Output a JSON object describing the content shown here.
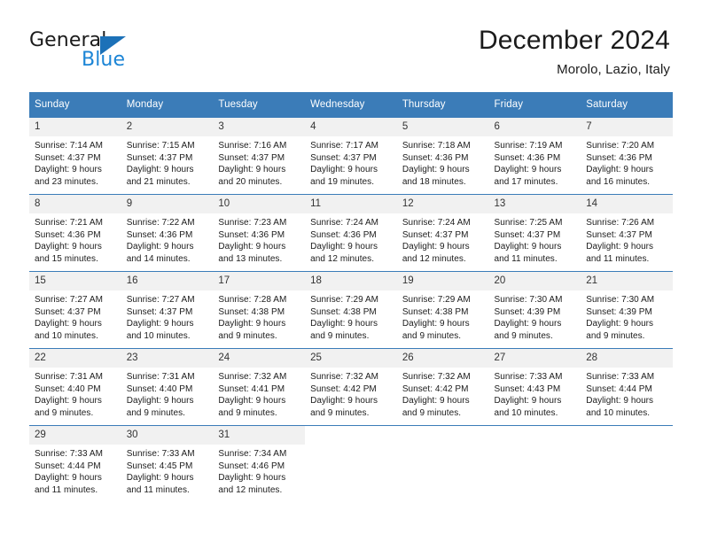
{
  "brand": {
    "name_dark": "General",
    "name_blue": "Blue",
    "accent_blue": "#1c85d6",
    "triangle_blue": "#1c71b8"
  },
  "header": {
    "title": "December 2024",
    "subtitle": "Morolo, Lazio, Italy"
  },
  "theme": {
    "header_bg": "#3b7cb8",
    "header_text": "#ffffff",
    "daynum_bg": "#f1f1f1",
    "cell_bg": "#ffffff",
    "grid_line": "#3b7cb8"
  },
  "weekdays": [
    "Sunday",
    "Monday",
    "Tuesday",
    "Wednesday",
    "Thursday",
    "Friday",
    "Saturday"
  ],
  "weeks": [
    [
      {
        "day": "1",
        "lines": [
          "Sunrise: 7:14 AM",
          "Sunset: 4:37 PM",
          "Daylight: 9 hours",
          "and 23 minutes."
        ]
      },
      {
        "day": "2",
        "lines": [
          "Sunrise: 7:15 AM",
          "Sunset: 4:37 PM",
          "Daylight: 9 hours",
          "and 21 minutes."
        ]
      },
      {
        "day": "3",
        "lines": [
          "Sunrise: 7:16 AM",
          "Sunset: 4:37 PM",
          "Daylight: 9 hours",
          "and 20 minutes."
        ]
      },
      {
        "day": "4",
        "lines": [
          "Sunrise: 7:17 AM",
          "Sunset: 4:37 PM",
          "Daylight: 9 hours",
          "and 19 minutes."
        ]
      },
      {
        "day": "5",
        "lines": [
          "Sunrise: 7:18 AM",
          "Sunset: 4:36 PM",
          "Daylight: 9 hours",
          "and 18 minutes."
        ]
      },
      {
        "day": "6",
        "lines": [
          "Sunrise: 7:19 AM",
          "Sunset: 4:36 PM",
          "Daylight: 9 hours",
          "and 17 minutes."
        ]
      },
      {
        "day": "7",
        "lines": [
          "Sunrise: 7:20 AM",
          "Sunset: 4:36 PM",
          "Daylight: 9 hours",
          "and 16 minutes."
        ]
      }
    ],
    [
      {
        "day": "8",
        "lines": [
          "Sunrise: 7:21 AM",
          "Sunset: 4:36 PM",
          "Daylight: 9 hours",
          "and 15 minutes."
        ]
      },
      {
        "day": "9",
        "lines": [
          "Sunrise: 7:22 AM",
          "Sunset: 4:36 PM",
          "Daylight: 9 hours",
          "and 14 minutes."
        ]
      },
      {
        "day": "10",
        "lines": [
          "Sunrise: 7:23 AM",
          "Sunset: 4:36 PM",
          "Daylight: 9 hours",
          "and 13 minutes."
        ]
      },
      {
        "day": "11",
        "lines": [
          "Sunrise: 7:24 AM",
          "Sunset: 4:36 PM",
          "Daylight: 9 hours",
          "and 12 minutes."
        ]
      },
      {
        "day": "12",
        "lines": [
          "Sunrise: 7:24 AM",
          "Sunset: 4:37 PM",
          "Daylight: 9 hours",
          "and 12 minutes."
        ]
      },
      {
        "day": "13",
        "lines": [
          "Sunrise: 7:25 AM",
          "Sunset: 4:37 PM",
          "Daylight: 9 hours",
          "and 11 minutes."
        ]
      },
      {
        "day": "14",
        "lines": [
          "Sunrise: 7:26 AM",
          "Sunset: 4:37 PM",
          "Daylight: 9 hours",
          "and 11 minutes."
        ]
      }
    ],
    [
      {
        "day": "15",
        "lines": [
          "Sunrise: 7:27 AM",
          "Sunset: 4:37 PM",
          "Daylight: 9 hours",
          "and 10 minutes."
        ]
      },
      {
        "day": "16",
        "lines": [
          "Sunrise: 7:27 AM",
          "Sunset: 4:37 PM",
          "Daylight: 9 hours",
          "and 10 minutes."
        ]
      },
      {
        "day": "17",
        "lines": [
          "Sunrise: 7:28 AM",
          "Sunset: 4:38 PM",
          "Daylight: 9 hours",
          "and 9 minutes."
        ]
      },
      {
        "day": "18",
        "lines": [
          "Sunrise: 7:29 AM",
          "Sunset: 4:38 PM",
          "Daylight: 9 hours",
          "and 9 minutes."
        ]
      },
      {
        "day": "19",
        "lines": [
          "Sunrise: 7:29 AM",
          "Sunset: 4:38 PM",
          "Daylight: 9 hours",
          "and 9 minutes."
        ]
      },
      {
        "day": "20",
        "lines": [
          "Sunrise: 7:30 AM",
          "Sunset: 4:39 PM",
          "Daylight: 9 hours",
          "and 9 minutes."
        ]
      },
      {
        "day": "21",
        "lines": [
          "Sunrise: 7:30 AM",
          "Sunset: 4:39 PM",
          "Daylight: 9 hours",
          "and 9 minutes."
        ]
      }
    ],
    [
      {
        "day": "22",
        "lines": [
          "Sunrise: 7:31 AM",
          "Sunset: 4:40 PM",
          "Daylight: 9 hours",
          "and 9 minutes."
        ]
      },
      {
        "day": "23",
        "lines": [
          "Sunrise: 7:31 AM",
          "Sunset: 4:40 PM",
          "Daylight: 9 hours",
          "and 9 minutes."
        ]
      },
      {
        "day": "24",
        "lines": [
          "Sunrise: 7:32 AM",
          "Sunset: 4:41 PM",
          "Daylight: 9 hours",
          "and 9 minutes."
        ]
      },
      {
        "day": "25",
        "lines": [
          "Sunrise: 7:32 AM",
          "Sunset: 4:42 PM",
          "Daylight: 9 hours",
          "and 9 minutes."
        ]
      },
      {
        "day": "26",
        "lines": [
          "Sunrise: 7:32 AM",
          "Sunset: 4:42 PM",
          "Daylight: 9 hours",
          "and 9 minutes."
        ]
      },
      {
        "day": "27",
        "lines": [
          "Sunrise: 7:33 AM",
          "Sunset: 4:43 PM",
          "Daylight: 9 hours",
          "and 10 minutes."
        ]
      },
      {
        "day": "28",
        "lines": [
          "Sunrise: 7:33 AM",
          "Sunset: 4:44 PM",
          "Daylight: 9 hours",
          "and 10 minutes."
        ]
      }
    ],
    [
      {
        "day": "29",
        "lines": [
          "Sunrise: 7:33 AM",
          "Sunset: 4:44 PM",
          "Daylight: 9 hours",
          "and 11 minutes."
        ]
      },
      {
        "day": "30",
        "lines": [
          "Sunrise: 7:33 AM",
          "Sunset: 4:45 PM",
          "Daylight: 9 hours",
          "and 11 minutes."
        ]
      },
      {
        "day": "31",
        "lines": [
          "Sunrise: 7:34 AM",
          "Sunset: 4:46 PM",
          "Daylight: 9 hours",
          "and 12 minutes."
        ]
      },
      {
        "day": "",
        "lines": []
      },
      {
        "day": "",
        "lines": []
      },
      {
        "day": "",
        "lines": []
      },
      {
        "day": "",
        "lines": []
      }
    ]
  ]
}
